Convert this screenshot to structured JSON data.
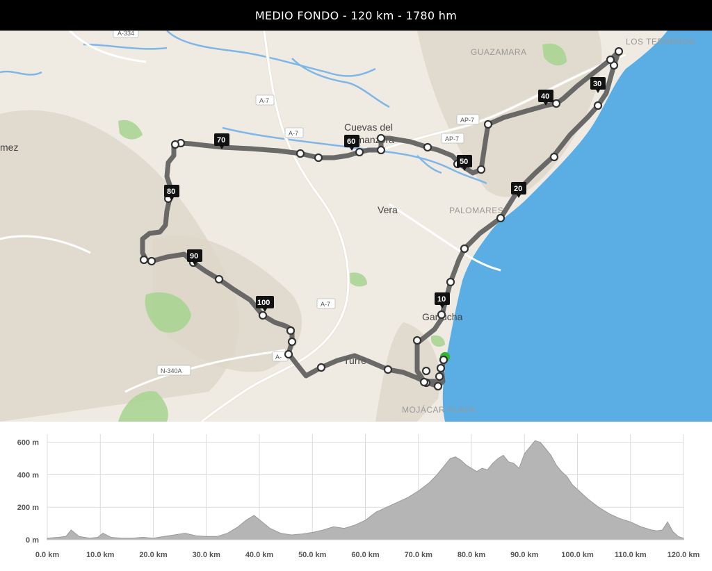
{
  "title": "MEDIO FONDO  -  120 km  -  1780 hm",
  "map": {
    "towns": [
      {
        "label": "Cuevas del"
      },
      {
        "label": "Almanzora"
      },
      {
        "label": "Vera"
      },
      {
        "label": "Garrucha"
      },
      {
        "label": "Turre"
      }
    ],
    "caps_places": [
      {
        "label": "GUAZAMARA"
      },
      {
        "label": "PALOMARES"
      },
      {
        "label": "LOS TERREROS"
      },
      {
        "label": "MOJÁCAR PLAYA"
      }
    ],
    "road_labels": [
      "A-334",
      "A-7",
      "A-7",
      "AP-7",
      "AP-7",
      "A-7",
      "N-340A",
      "A-"
    ],
    "edge_text": "mez",
    "km_markers": [
      "10",
      "20",
      "30",
      "40",
      "50",
      "60",
      "70",
      "80",
      "90",
      "100"
    ],
    "colors": {
      "route": "#5e5e5e",
      "sea": "#5aaee3",
      "land": "#efebe2",
      "start": "#2eb82e"
    }
  },
  "chart_data": {
    "type": "area",
    "title": "",
    "xlabel": "",
    "ylabel": "",
    "xlim": [
      0,
      120
    ],
    "ylim": [
      0,
      650
    ],
    "x_ticks": [
      "0.0 km",
      "10.0 km",
      "20.0 km",
      "30.0 km",
      "40.0 km",
      "50.0 km",
      "60.0 km",
      "70.0 km",
      "80.0 km",
      "90.0 km",
      "100.0 km",
      "110.0 km",
      "120.0 km"
    ],
    "y_ticks": [
      "0 m",
      "200 m",
      "400 m",
      "600 m"
    ],
    "grid": true,
    "series": [
      {
        "x": [
          0,
          2,
          3.5,
          4.5,
          6,
          8,
          9.5,
          10.5,
          12,
          14,
          16,
          18,
          20,
          22,
          24,
          26,
          28,
          30,
          32,
          34,
          36,
          37.5,
          39,
          40.5,
          42,
          44,
          46,
          48,
          50,
          52,
          54,
          56,
          58,
          60,
          62,
          64,
          66,
          68,
          70,
          72,
          73.5,
          75,
          76,
          77,
          78,
          79,
          80,
          81,
          82,
          83,
          84,
          85,
          86,
          87,
          88,
          89,
          90,
          91,
          92,
          93,
          94,
          95,
          96,
          97,
          98,
          99,
          100,
          102,
          104,
          106,
          108,
          110,
          112,
          114,
          115,
          116,
          117,
          118,
          119,
          120
        ],
        "y": [
          10,
          15,
          20,
          60,
          20,
          10,
          15,
          40,
          15,
          10,
          10,
          15,
          10,
          20,
          30,
          40,
          25,
          20,
          20,
          40,
          80,
          120,
          150,
          110,
          70,
          40,
          30,
          35,
          45,
          60,
          80,
          70,
          90,
          120,
          170,
          200,
          230,
          260,
          300,
          350,
          400,
          460,
          500,
          510,
          490,
          460,
          440,
          420,
          440,
          430,
          470,
          500,
          520,
          480,
          470,
          440,
          530,
          570,
          610,
          600,
          560,
          520,
          460,
          420,
          390,
          340,
          310,
          250,
          200,
          160,
          130,
          110,
          80,
          60,
          55,
          60,
          110,
          50,
          20,
          10
        ]
      }
    ]
  }
}
